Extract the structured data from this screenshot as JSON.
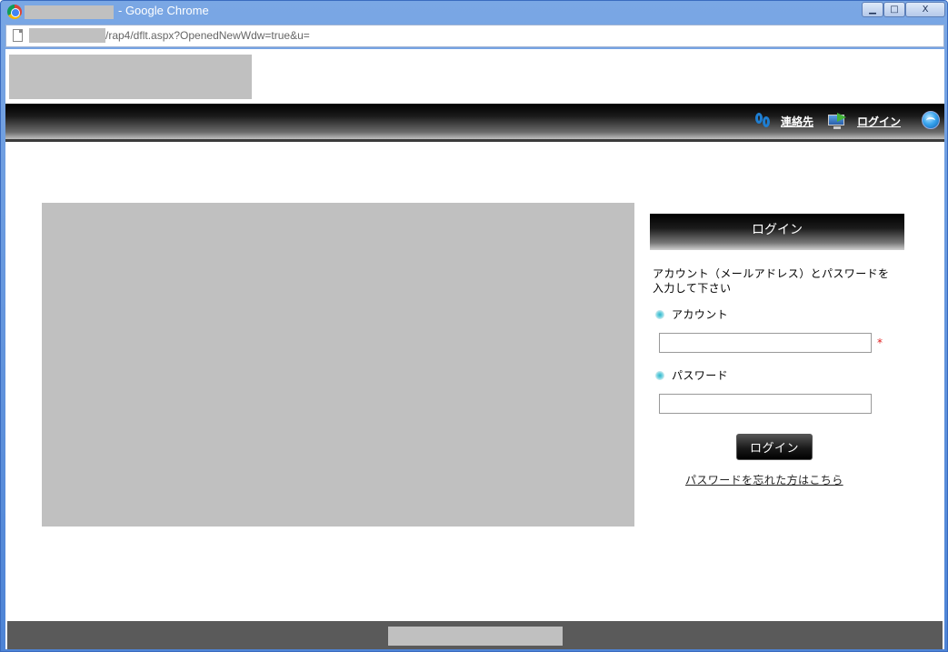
{
  "window": {
    "title_suffix": "- Google Chrome",
    "controls": {
      "minimize": "▁",
      "maximize": "□",
      "close": "X"
    }
  },
  "address_bar": {
    "url_tail": "/rap4/dflt.aspx?OpenedNewWdw=true&u="
  },
  "nav": {
    "contact_label": "連絡先",
    "login_label": "ログイン"
  },
  "login_panel": {
    "header": "ログイン",
    "instructions": "アカウント（メールアドレス）とパスワードを入力して下さい",
    "account_label": "アカウント",
    "account_value": "",
    "required_mark": "*",
    "password_label": "パスワード",
    "password_value": "",
    "submit_label": "ログイン",
    "forgot_link": "パスワードを忘れた方はこちら"
  },
  "colors": {
    "titlebar": "#4e84d6",
    "footer": "#5a5a5a",
    "redaction": "#c0c0c0",
    "required": "#e02020",
    "bullet": "#2fb3c8"
  }
}
